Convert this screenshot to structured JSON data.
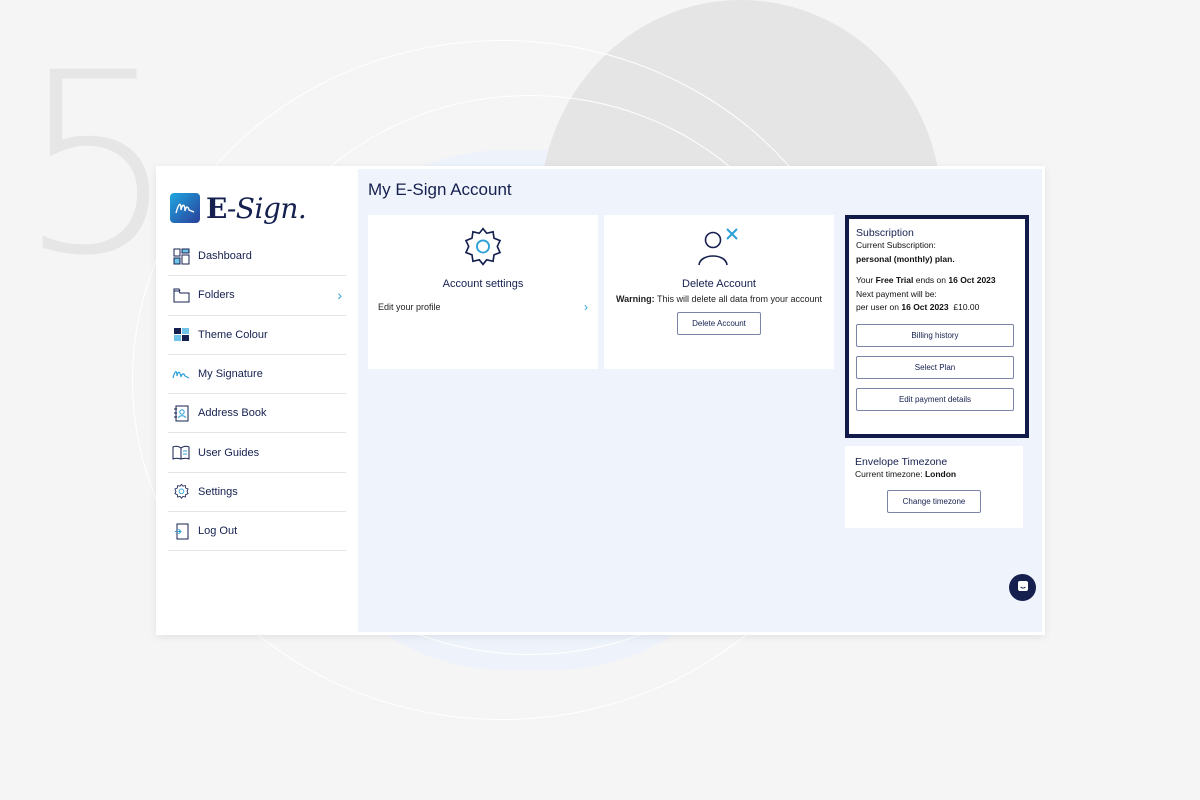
{
  "step_number": "5",
  "app": {
    "logo_text_main": "E",
    "logo_text_script": "-Sign."
  },
  "sidebar": {
    "items": [
      {
        "label": "Dashboard",
        "icon": "dashboard-icon"
      },
      {
        "label": "Folders",
        "icon": "folder-icon",
        "has_chevron": true
      },
      {
        "label": "Theme Colour",
        "icon": "theme-icon"
      },
      {
        "label": "My Signature",
        "icon": "signature-icon"
      },
      {
        "label": "Address Book",
        "icon": "address-book-icon"
      },
      {
        "label": "User Guides",
        "icon": "book-icon"
      },
      {
        "label": "Settings",
        "icon": "gear-icon"
      },
      {
        "label": "Log Out",
        "icon": "logout-icon"
      }
    ]
  },
  "main": {
    "title": "My E-Sign Account",
    "account_card": {
      "title": "Account settings",
      "link": "Edit your profile"
    },
    "delete_card": {
      "title": "Delete Account",
      "warning_label": "Warning:",
      "warning_text": "This will delete all data from your account",
      "button": "Delete Account"
    },
    "subscription": {
      "title": "Subscription",
      "current_label": "Current Subscription:",
      "plan": "personal (monthly) plan.",
      "trial_prefix": "Your",
      "trial_bold": "Free Trial",
      "trial_mid": "ends on",
      "trial_date": "16 Oct 2023",
      "next_payment": "Next payment will be:",
      "per_user_prefix": "per user on",
      "per_user_date": "16 Oct 2023",
      "amount": "£10.00",
      "buttons": [
        "Billing history",
        "Select Plan",
        "Edit payment details"
      ]
    },
    "timezone": {
      "title": "Envelope Timezone",
      "label": "Current timezone:",
      "value": "London",
      "button": "Change timezone"
    }
  },
  "colors": {
    "navy": "#15204f",
    "accent": "#2a9fd8",
    "main_bg": "#eff4fc"
  }
}
